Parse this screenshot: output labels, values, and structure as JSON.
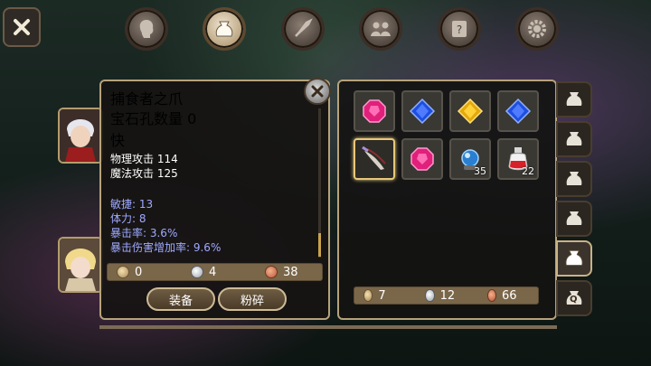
{
  "top_bar": {
    "tabs": [
      {
        "icon": "head-icon",
        "active": false
      },
      {
        "icon": "bag-icon",
        "active": true
      },
      {
        "icon": "feather-icon",
        "active": false
      },
      {
        "icon": "group-icon",
        "active": false
      },
      {
        "icon": "scroll-icon",
        "active": false
      },
      {
        "icon": "gear-icon",
        "active": false
      }
    ]
  },
  "item": {
    "name": "捕食者之爪",
    "sockets": "宝石孔数量 0",
    "speed": "快",
    "phys_attack": "物理攻击 114",
    "magic_attack": "魔法攻击 125",
    "agility": "敏捷: 13",
    "stamina": "体力: 8",
    "crit_rate": "暴击率: 3.6%",
    "crit_damage": "暴击伤害增加率: 9.6%",
    "price": {
      "gold": "0",
      "silver": "4",
      "copper": "38"
    },
    "equip_label": "装备",
    "shatter_label": "粉碎"
  },
  "inventory": {
    "slots": [
      {
        "icon": "pink-gem-icon",
        "count": ""
      },
      {
        "icon": "blue-gem-icon",
        "count": ""
      },
      {
        "icon": "yellow-gem-icon",
        "count": ""
      },
      {
        "icon": "blue-gem-icon",
        "count": ""
      },
      {
        "icon": "claw-weapon-icon",
        "count": "",
        "selected": true
      },
      {
        "icon": "pink-gem-icon",
        "count": ""
      },
      {
        "icon": "blue-orb-icon",
        "count": "35"
      },
      {
        "icon": "red-potion-icon",
        "count": "22"
      }
    ],
    "money": {
      "gold": "7",
      "silver": "12",
      "copper": "66"
    },
    "side_tabs": [
      {
        "icon": "bag-icon",
        "active": false
      },
      {
        "icon": "bag-icon",
        "active": false
      },
      {
        "icon": "bag-icon",
        "active": false
      },
      {
        "icon": "bag-icon",
        "active": false
      },
      {
        "icon": "bag-icon",
        "active": true
      },
      {
        "icon": "quest-bag-icon",
        "active": false,
        "label": "Q"
      }
    ]
  },
  "colors": {
    "item_name": "#c77dff",
    "stat_bonus": "#9eaaff",
    "panel_border": "#b7a27b"
  }
}
